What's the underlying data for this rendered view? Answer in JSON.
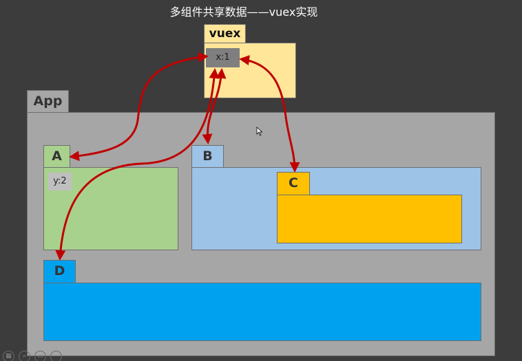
{
  "title": "多组件共享数据——vuex实现",
  "vuex": {
    "label": "vuex",
    "state_value": "x:1"
  },
  "app": {
    "label": "App"
  },
  "components": {
    "a": {
      "label": "A",
      "state_value": "y:2"
    },
    "b": {
      "label": "B"
    },
    "c": {
      "label": "C"
    },
    "d": {
      "label": "D"
    }
  },
  "colors": {
    "background": "#3c3c3c",
    "vuex": "#ffe699",
    "app": "#a6a6a6",
    "a": "#a9d18e",
    "b": "#9dc3e6",
    "c": "#ffc000",
    "d": "#00a2f0",
    "arrow": "#c00000",
    "state_chip": "#7f7f7f"
  },
  "toolbar_icons": [
    "grid-icon",
    "zoom-icon",
    "screen-icon",
    "more-icon"
  ]
}
